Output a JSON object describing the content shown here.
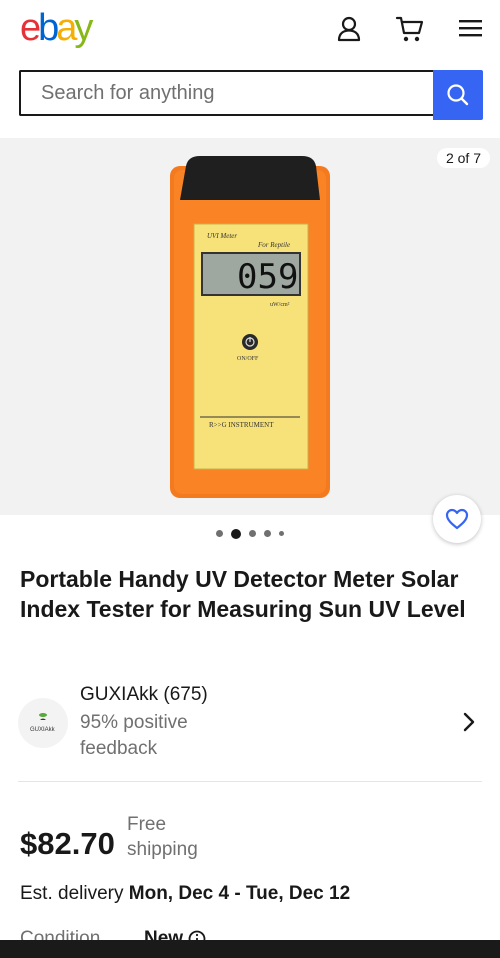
{
  "header": {
    "logo_letters": [
      "e",
      "b",
      "a",
      "y"
    ],
    "logo_colors": [
      "#e53238",
      "#0064d2",
      "#f5af02",
      "#86b817"
    ],
    "icons": [
      "user-icon",
      "cart-icon",
      "menu-icon"
    ]
  },
  "search": {
    "placeholder": "Search for anything",
    "button_icon": "search-icon",
    "accent_color": "#3665f3"
  },
  "gallery": {
    "counter": "2 of 7",
    "image_count": 7,
    "current_index": 2,
    "product_image": {
      "meter_label": "UVI Meter",
      "sub_label": "For Reptile",
      "display_value": "059",
      "unit": "uW/cm²",
      "power_label": "ON/OFF",
      "brand": "R>>G INSTRUMENT"
    },
    "favorite_icon": "heart-icon"
  },
  "product": {
    "title": "Portable Handy UV Detector Meter Solar Index Tester for Measuring Sun UV Level"
  },
  "seller": {
    "logo_text": "GUXIAkk",
    "name": "GUXIAkk (675)",
    "feedback": "95% positive feedback",
    "chevron_icon": "chevron-right-icon"
  },
  "pricing": {
    "price": "$82.70",
    "shipping": "Free shipping"
  },
  "delivery": {
    "label": "Est. delivery",
    "dates": "Mon, Dec 4 - Tue, Dec 12"
  },
  "condition": {
    "label": "Condition",
    "value": "New",
    "info_icon": "info-icon"
  }
}
